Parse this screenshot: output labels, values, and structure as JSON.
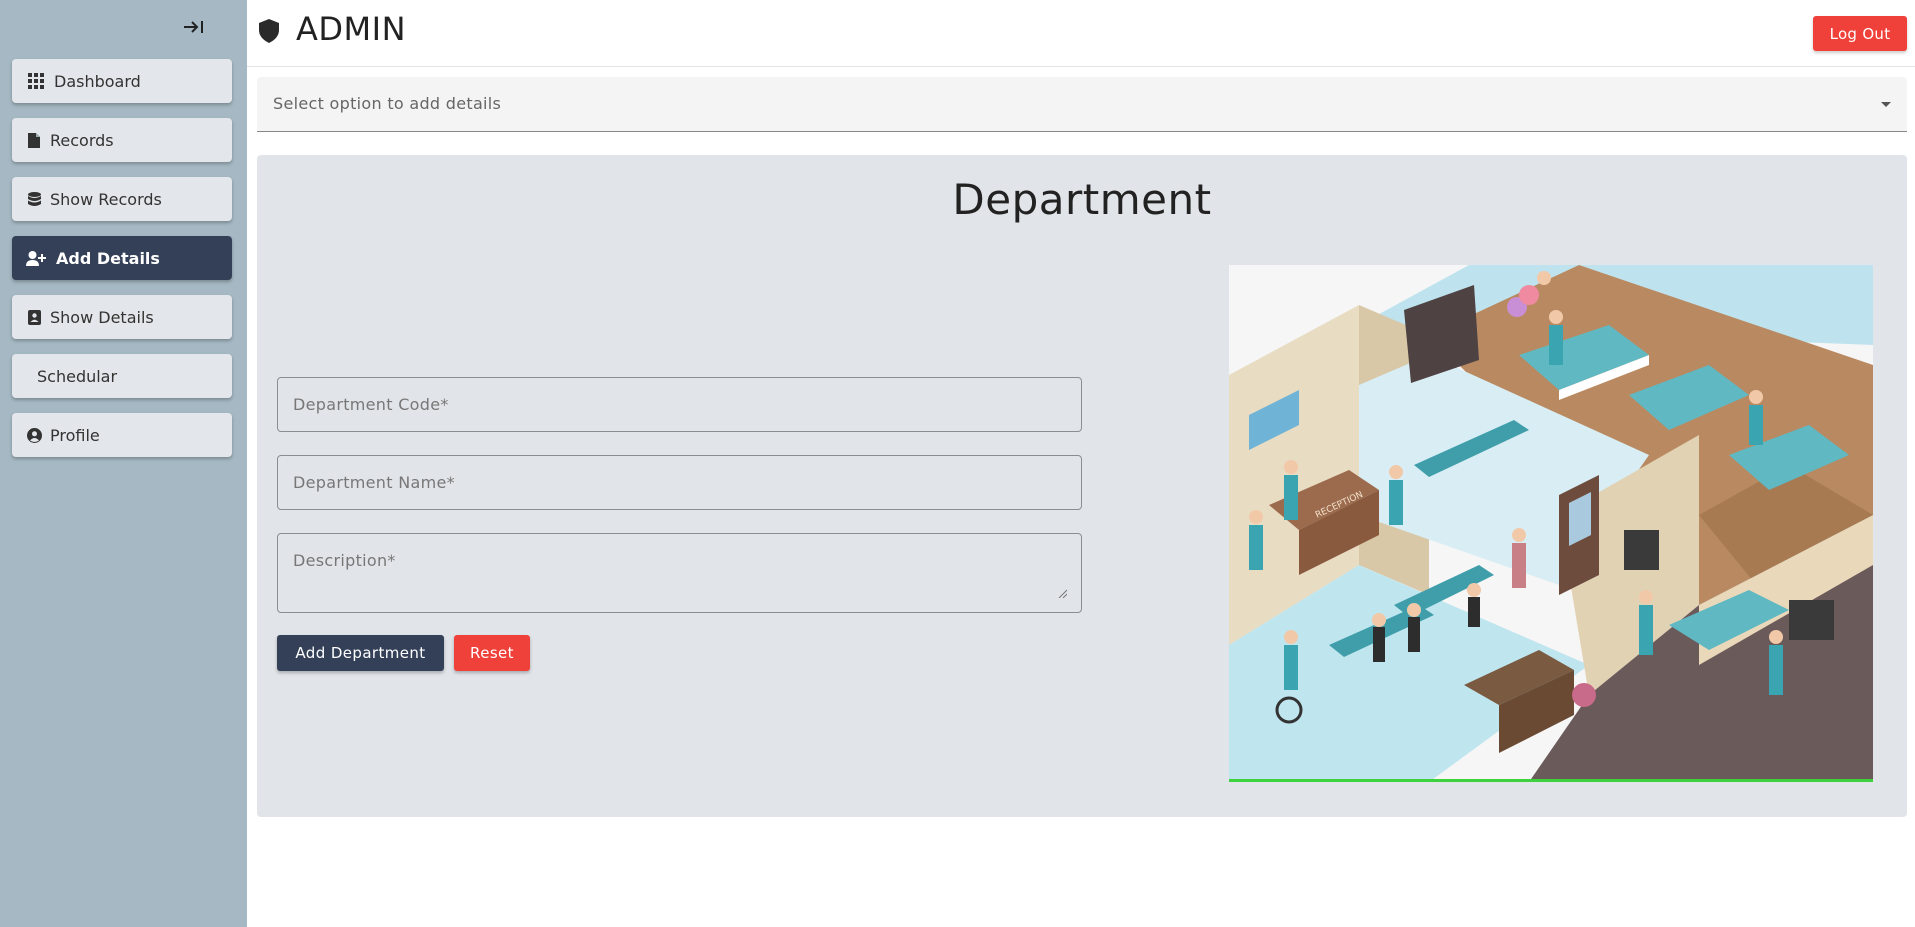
{
  "sidebar": {
    "items": [
      {
        "label": "Dashboard",
        "icon": "grid-icon"
      },
      {
        "label": "Records",
        "icon": "file-icon"
      },
      {
        "label": "Show Records",
        "icon": "database-icon"
      },
      {
        "label": "Add Details",
        "icon": "user-plus-icon",
        "active": true
      },
      {
        "label": "Show Details",
        "icon": "contact-card-icon"
      },
      {
        "label": "Schedular",
        "icon": ""
      },
      {
        "label": "Profile",
        "icon": "user-circle-icon"
      }
    ]
  },
  "header": {
    "title": "ADMIN",
    "logout_label": "Log Out"
  },
  "select": {
    "placeholder": "Select option to add details"
  },
  "form": {
    "title": "Department",
    "code_placeholder": "Department Code*",
    "name_placeholder": "Department Name*",
    "description_placeholder": "Description*",
    "add_label": "Add Department",
    "reset_label": "Reset",
    "reception_sign": "RECEPTION"
  },
  "colors": {
    "sidebar_bg": "#a5b8c3",
    "active_nav": "#334058",
    "danger": "#f0403a",
    "panel_bg": "#e1e4e8"
  }
}
